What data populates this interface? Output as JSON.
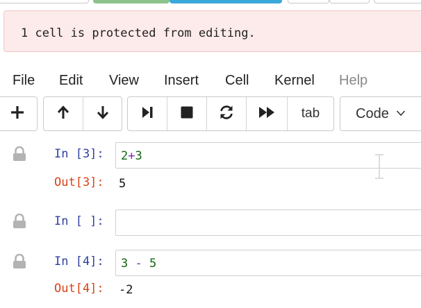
{
  "banner": {
    "message": "1 cell is protected from editing."
  },
  "menu": {
    "items": [
      {
        "label": "File",
        "dim": false
      },
      {
        "label": "Edit",
        "dim": false
      },
      {
        "label": "View",
        "dim": false
      },
      {
        "label": "Insert",
        "dim": false
      },
      {
        "label": "Cell",
        "dim": false
      },
      {
        "label": "Kernel",
        "dim": false
      },
      {
        "label": "Help",
        "dim": true
      }
    ]
  },
  "toolbar": {
    "icons": {
      "add": "plus-icon",
      "move_up": "arrow-up-icon",
      "move_down": "arrow-down-icon",
      "run": "step-forward-icon",
      "stop": "stop-icon",
      "restart": "refresh-icon",
      "run_all": "fast-forward-icon"
    },
    "tab_label": "tab",
    "cell_type": "Code"
  },
  "cells": [
    {
      "in_prompt": "In [3]:",
      "code_a": "2",
      "code_op": "+",
      "code_b": "3",
      "out_prompt": "Out[3]:",
      "output": "5"
    },
    {
      "in_prompt": "In [ ]:",
      "code_a": "",
      "code_op": "",
      "code_b": "",
      "out_prompt": "",
      "output": ""
    },
    {
      "in_prompt": "In [4]:",
      "code_a": "3",
      "code_op": " - ",
      "code_b": "5",
      "out_prompt": "Out[4]:",
      "output": "-2"
    }
  ],
  "colors": {
    "in_prompt": "#303f9f",
    "out_prompt": "#d84315",
    "banner_bg": "#fdebeb"
  }
}
